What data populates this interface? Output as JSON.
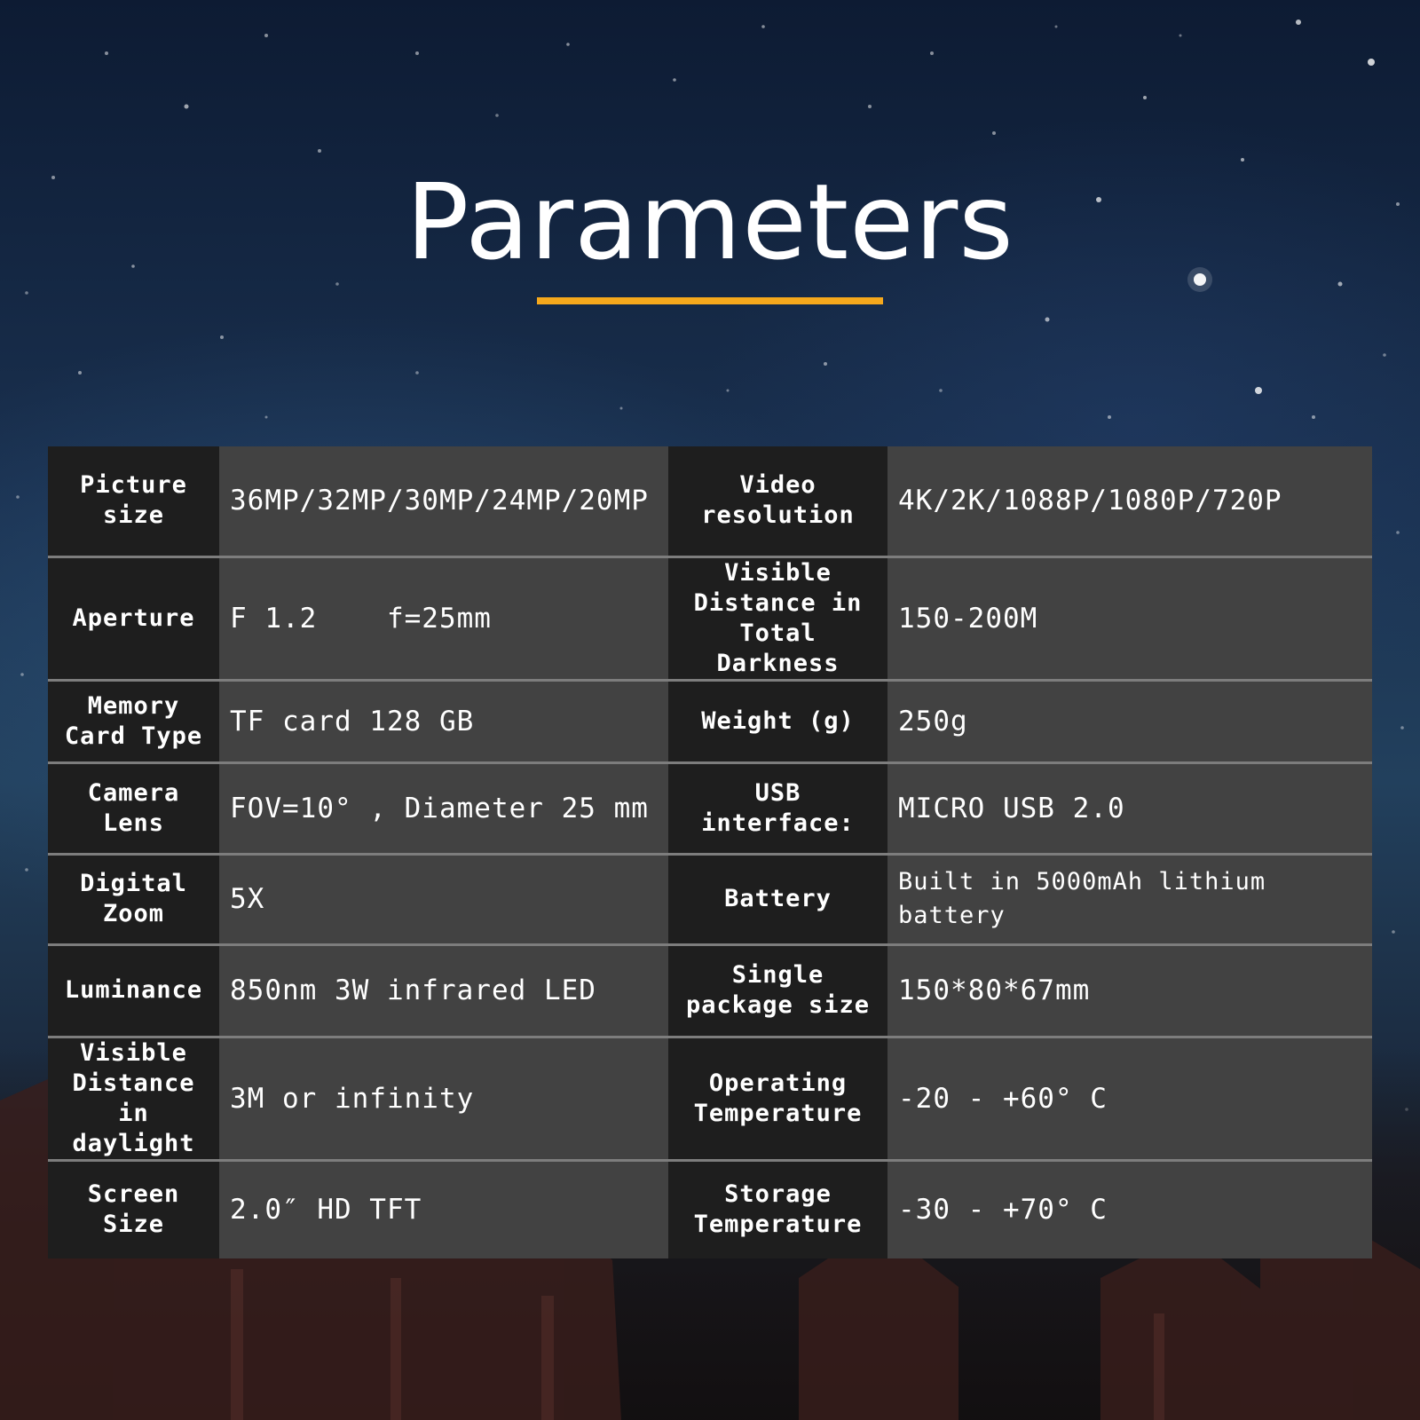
{
  "title": "Parameters",
  "colors": {
    "accent": "#f5a81c",
    "label_bg": "#1e1e1e",
    "value_bg": "#424242",
    "divider": "#7d7d7d"
  },
  "rows": [
    {
      "left_label": "Picture size",
      "left_value": "36MP/32MP/30MP/24MP/20MP",
      "right_label": "Video resolution",
      "right_value": "4K/2K/1088P/1080P/720P"
    },
    {
      "left_label": "Aperture",
      "left_value": "F 1.2    f=25mm",
      "right_label": "Visible Distance in Total Darkness",
      "right_value": "150-200M"
    },
    {
      "left_label": "Memory Card Type",
      "left_value": "TF card 128 GB",
      "right_label": "Weight (g)",
      "right_value": "250g"
    },
    {
      "left_label": "Camera Lens",
      "left_value": "FOV=10° , Diameter 25 mm",
      "right_label": "USB interface:",
      "right_value": "MICRO USB 2.0"
    },
    {
      "left_label": "Digital Zoom",
      "left_value": "5X",
      "right_label": "Battery",
      "right_value": "Built in 5000mAh lithium battery"
    },
    {
      "left_label": "Luminance",
      "left_value": "850nm 3W infrared LED",
      "right_label": "Single package size",
      "right_value": "150*80*67mm"
    },
    {
      "left_label": "Visible Distance in daylight",
      "left_value": "3M or infinity",
      "right_label": "Operating Temperature",
      "right_value": "-20 - +60° C"
    },
    {
      "left_label": "Screen Size",
      "left_value": "2.0″ HD TFT",
      "right_label": "Storage Temperature",
      "right_value": "-30 - +70° C"
    }
  ]
}
